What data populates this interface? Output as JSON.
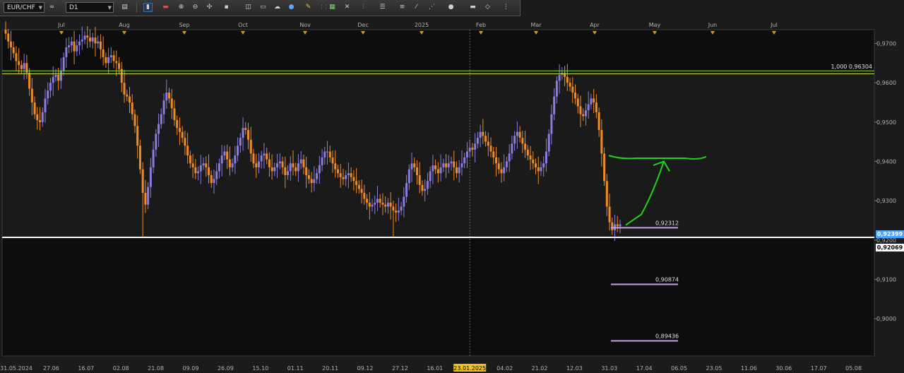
{
  "toolbar": {
    "symbol": "EUR/CHF",
    "timeframe": "D1",
    "icons": [
      "symbol-link-icon",
      "bar-chart-icon",
      "chart-style-icon",
      "line-chart-icon",
      "zoom-in-icon",
      "zoom-out-icon",
      "crosshair-icon",
      "shapes-icon",
      "template-icon",
      "cloud-icon",
      "globe-icon",
      "pencil-icon",
      "grid-icon",
      "indicator-icon",
      "fibonacci-icon",
      "hline-icon",
      "dots-icon",
      "color-icon",
      "eraser-icon",
      "more-icon"
    ]
  },
  "colors": {
    "background": "#1b1b1b",
    "plot": "#0d0d0d",
    "plot_upper": "#1a1a1a",
    "bull": "#8a7de0",
    "bear": "#ef8b25",
    "support": "#ffffff",
    "fib": "#7ddc45",
    "fib2": "#c7d94a",
    "target_lines": "#c79ff0",
    "arrow": "#22d11f",
    "last_price_bg": "#4aa3ff",
    "axis_text": "#b0b0b0",
    "month_marker": "#c99a2e"
  },
  "chart_data": {
    "type": "candlestick",
    "instrument": "EUR/CHF",
    "timeframe": "D1",
    "ylim": [
      0.8905,
      0.9735
    ],
    "y_ticks": [
      "0,9700",
      "0,9600",
      "0,9500",
      "0,9400",
      "0,9300",
      "0,9200",
      "0,9100",
      "0,9000"
    ],
    "x_ticks": [
      "31.05.2024",
      "27.06",
      "16.07",
      "02.08",
      "21.08",
      "09.09",
      "26.09",
      "15.10",
      "01.11",
      "20.11",
      "09.12",
      "27.12",
      "16.01",
      "23.01.2025",
      "04.02",
      "21.02",
      "12.03",
      "31.03",
      "17.04",
      "06.05",
      "23.05",
      "11.06",
      "30.06",
      "17.07",
      "05.08"
    ],
    "month_labels": [
      "Jul",
      "Aug",
      "Sep",
      "Oct",
      "Nov",
      "Dec",
      "2025",
      "Feb",
      "Mar",
      "Apr",
      "May",
      "Jun",
      "Jul"
    ],
    "highlight_date": "23.01.2025",
    "levels": [
      {
        "name": "fib-100",
        "value": 0.96304,
        "label": "1,000 0,96304",
        "color": "#7ddc45"
      },
      {
        "name": "fib-upper",
        "value": 0.963,
        "label": "",
        "color": "#c7d94a"
      },
      {
        "name": "support",
        "value": 0.92069,
        "label": "0,92069",
        "color": "#ffffff"
      },
      {
        "name": "target-1",
        "value": 0.92312,
        "label": "0,92312",
        "color": "#c79ff0"
      },
      {
        "name": "target-2",
        "value": 0.90874,
        "label": "0,90874",
        "color": "#c79ff0"
      },
      {
        "name": "target-3",
        "value": 0.89436,
        "label": "0,89436",
        "color": "#c79ff0"
      }
    ],
    "last_price": "0,92399",
    "support_tag": "0,92069",
    "closes": [
      0.9725,
      0.9705,
      0.969,
      0.9675,
      0.9655,
      0.9645,
      0.9635,
      0.965,
      0.9625,
      0.9585,
      0.955,
      0.952,
      0.9505,
      0.95,
      0.9525,
      0.956,
      0.958,
      0.96,
      0.9615,
      0.962,
      0.9605,
      0.963,
      0.9665,
      0.969,
      0.9695,
      0.9705,
      0.968,
      0.9695,
      0.9705,
      0.971,
      0.972,
      0.9715,
      0.9705,
      0.9715,
      0.97,
      0.9705,
      0.9685,
      0.9665,
      0.965,
      0.9665,
      0.967,
      0.9655,
      0.965,
      0.9635,
      0.96,
      0.957,
      0.9565,
      0.955,
      0.952,
      0.949,
      0.944,
      0.938,
      0.932,
      0.929,
      0.9335,
      0.9385,
      0.943,
      0.947,
      0.9495,
      0.952,
      0.9555,
      0.9575,
      0.956,
      0.9535,
      0.9505,
      0.9485,
      0.9475,
      0.946,
      0.944,
      0.9415,
      0.9395,
      0.9385,
      0.937,
      0.9375,
      0.939,
      0.9395,
      0.9385,
      0.9365,
      0.9345,
      0.9355,
      0.9375,
      0.9395,
      0.9415,
      0.9425,
      0.9405,
      0.9385,
      0.9395,
      0.9415,
      0.944,
      0.946,
      0.9485,
      0.948,
      0.9455,
      0.942,
      0.9395,
      0.9385,
      0.94,
      0.9415,
      0.942,
      0.9405,
      0.9385,
      0.9375,
      0.9385,
      0.9395,
      0.94,
      0.9385,
      0.9365,
      0.9375,
      0.9395,
      0.9385,
      0.9375,
      0.9395,
      0.9405,
      0.9385,
      0.9365,
      0.9355,
      0.9345,
      0.9355,
      0.937,
      0.939,
      0.941,
      0.9425,
      0.9425,
      0.941,
      0.9395,
      0.938,
      0.937,
      0.936,
      0.9355,
      0.9365,
      0.937,
      0.936,
      0.935,
      0.934,
      0.933,
      0.932,
      0.9305,
      0.9295,
      0.9285,
      0.929,
      0.9295,
      0.9305,
      0.9295,
      0.929,
      0.9285,
      0.9295,
      0.9285,
      0.9275,
      0.927,
      0.9275,
      0.9285,
      0.931,
      0.9345,
      0.938,
      0.9395,
      0.9385,
      0.9365,
      0.934,
      0.9325,
      0.933,
      0.935,
      0.9375,
      0.939,
      0.938,
      0.937,
      0.9385,
      0.9395,
      0.9385,
      0.9395,
      0.94,
      0.9385,
      0.937,
      0.9385,
      0.9395,
      0.941,
      0.9425,
      0.9435,
      0.943,
      0.9445,
      0.946,
      0.9475,
      0.9465,
      0.945,
      0.944,
      0.9425,
      0.941,
      0.9395,
      0.938,
      0.937,
      0.9385,
      0.94,
      0.942,
      0.9445,
      0.9465,
      0.9475,
      0.946,
      0.9445,
      0.943,
      0.9415,
      0.9405,
      0.9395,
      0.9385,
      0.9375,
      0.9385,
      0.9395,
      0.9425,
      0.947,
      0.952,
      0.9565,
      0.9605,
      0.962,
      0.9625,
      0.9615,
      0.96,
      0.959,
      0.9575,
      0.956,
      0.954,
      0.952,
      0.9515,
      0.953,
      0.9545,
      0.956,
      0.955,
      0.9525,
      0.948,
      0.942,
      0.935,
      0.9285,
      0.9245,
      0.9225,
      0.924,
      0.9235,
      0.924
    ]
  }
}
